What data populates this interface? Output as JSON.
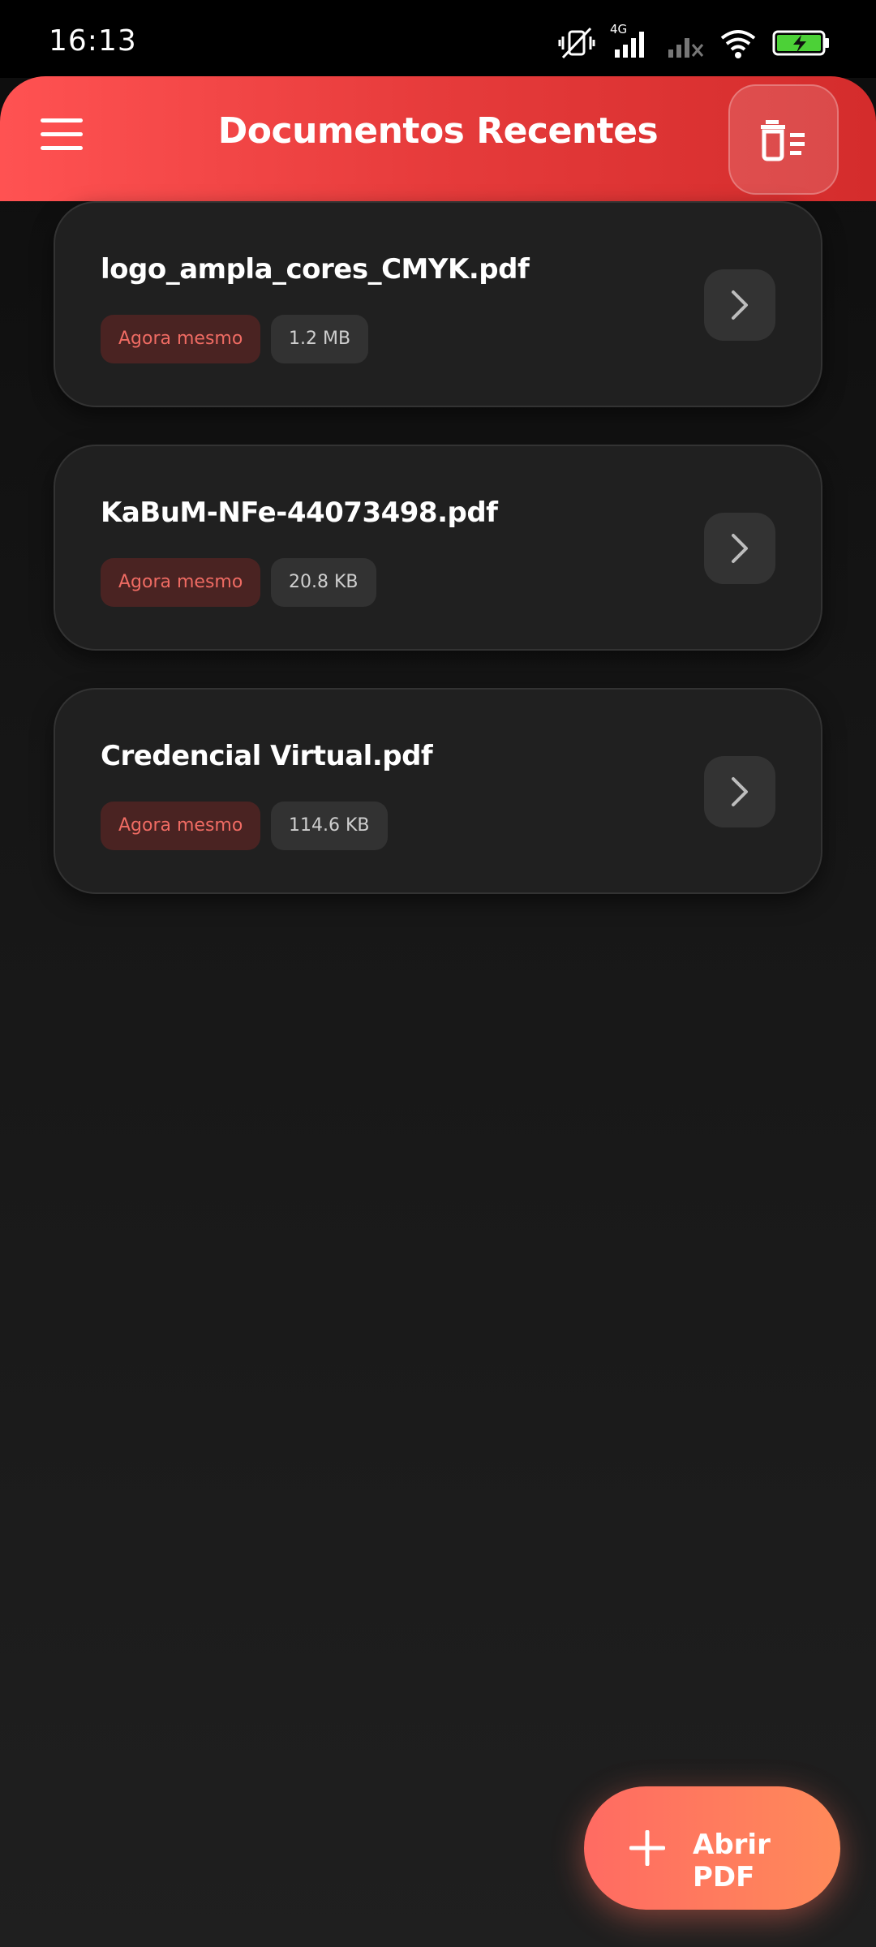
{
  "status_bar": {
    "time": "16:13",
    "network_label": "4G",
    "icons": [
      "vibrate-silent-icon",
      "signal-4g-icon",
      "signal-no-sim-icon",
      "wifi-icon",
      "battery-charging-icon"
    ]
  },
  "header": {
    "title": "Documentos Recentes",
    "menu_icon": "hamburger-menu-icon",
    "clear_icon": "clear-history-icon"
  },
  "documents": [
    {
      "name": "logo_ampla_cores_CMYK.pdf",
      "time": "Agora mesmo",
      "size": "1.2 MB"
    },
    {
      "name": "KaBuM-NFe-44073498.pdf",
      "time": "Agora mesmo",
      "size": "20.8 KB"
    },
    {
      "name": "Credencial Virtual.pdf",
      "time": "Agora mesmo",
      "size": "114.6 KB"
    }
  ],
  "fab": {
    "label": "Abrir PDF",
    "icon": "plus-icon"
  },
  "colors": {
    "accent": "#ff5252",
    "badge_time_text": "#ef6b63",
    "card_bg": "#202020",
    "fab_start": "#ff6b62",
    "fab_end": "#ff8a5a"
  }
}
